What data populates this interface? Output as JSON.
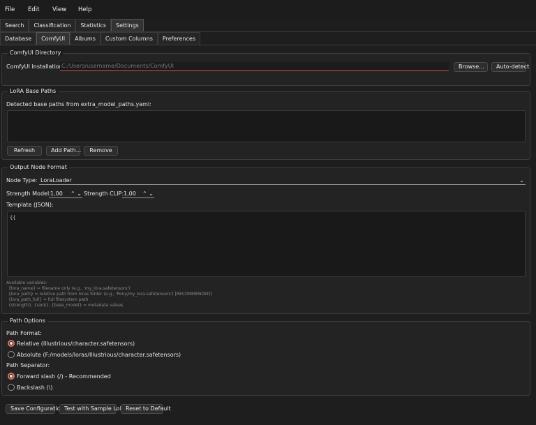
{
  "menu": {
    "file": "File",
    "edit": "Edit",
    "view": "View",
    "help": "Help"
  },
  "main_tabs": [
    "Search",
    "Classification",
    "Statistics",
    "Settings"
  ],
  "settings_tabs": [
    "Database",
    "ComfyUI",
    "Albums",
    "Custom Columns",
    "Preferences"
  ],
  "comfy_dir": {
    "title": "ComfyUI Directory",
    "install_label": "ComfyUI Installation:",
    "install_placeholder": "C:/Users/username/Documents/ComfyUI",
    "browse": "Browse...",
    "auto_detect": "Auto-detect"
  },
  "lora_paths": {
    "title": "LoRA Base Paths",
    "detected_label": "Detected base paths from extra_model_paths.yaml:",
    "refresh": "Refresh",
    "add_path": "Add Path...",
    "remove": "Remove"
  },
  "output_format": {
    "title": "Output Node Format",
    "node_type_label": "Node Type:",
    "node_type_value": "LoraLoader",
    "strength_model_label": "Strength Model:",
    "strength_model_value": "1,00",
    "strength_clip_label": "Strength CLIP:",
    "strength_clip_value": "1,00",
    "template_label": "Template (JSON):",
    "template_value": "{{",
    "vars_title": "Available variables:",
    "vars": [
      "{lora_name} = filename only (e.g., 'my_lora.safetensors')",
      "{lora_path} = relative path from loras folder (e.g., 'Pony/my_lora.safetensors') [RECOMMENDED]",
      "{lora_path_full} = full filesystem path",
      "{strength}, {rank}, {base_model} = metadata values"
    ]
  },
  "path_options": {
    "title": "Path Options",
    "format_label": "Path Format:",
    "relative": "Relative (Illustrious/character.safetensors)",
    "absolute": "Absolute (F:/models/loras/Illustrious/character.safetensors)",
    "separator_label": "Path Separator:",
    "forward": "Forward slash (/) - Recommended",
    "backslash": "Backslash (\\)"
  },
  "footer": {
    "save": "Save Configuration",
    "test": "Test with Sample LoRA",
    "reset": "Reset to Default"
  },
  "colors": {
    "accent": "#e0705e",
    "background": "#1e1e1e"
  }
}
